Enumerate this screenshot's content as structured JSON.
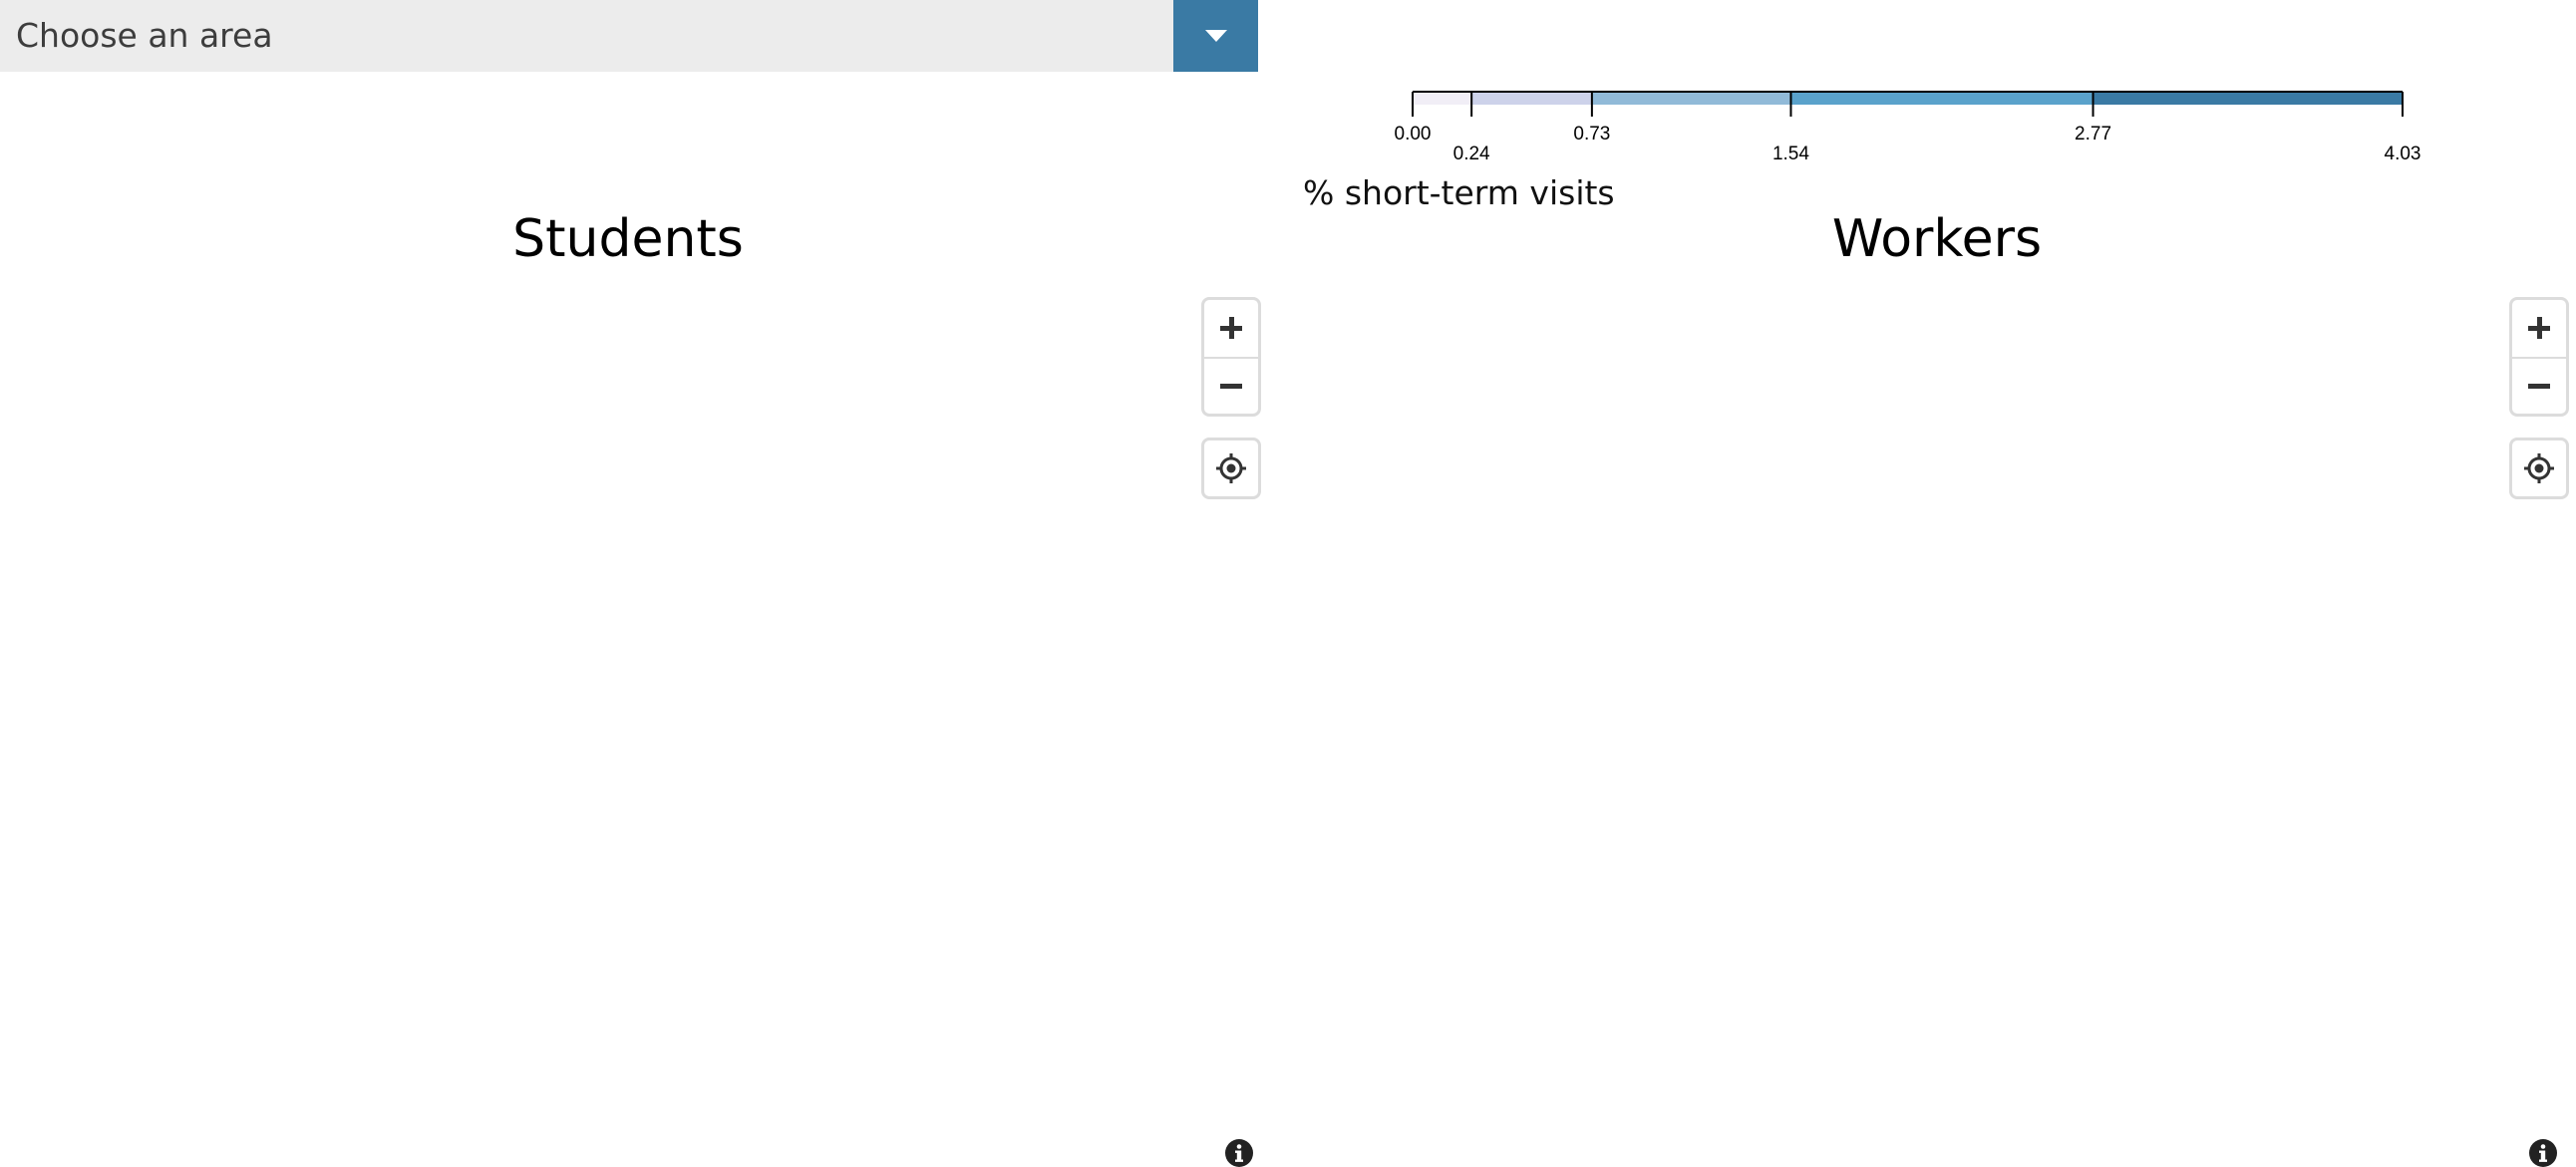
{
  "area_select": {
    "value": "Choose an area",
    "arrow_icon": "caret-down-icon",
    "accent_color": "#3a7aa4"
  },
  "legend": {
    "title": "% short-term visits",
    "breaks": [
      0.0,
      0.24,
      0.73,
      1.54,
      2.77,
      4.03
    ],
    "tick_labels": [
      "0.00",
      "0.24",
      "0.73",
      "1.54",
      "2.77",
      "4.03"
    ],
    "colors": [
      "#f1eef6",
      "#cdd2ea",
      "#91bad8",
      "#5aa2cb",
      "#3a7aa4"
    ]
  },
  "panels": {
    "students": {
      "title": "Students",
      "zoom_in_icon": "plus-icon",
      "zoom_out_icon": "minus-icon",
      "locate_icon": "locate-icon",
      "info_icon": "info-icon"
    },
    "workers": {
      "title": "Workers",
      "zoom_in_icon": "plus-icon",
      "zoom_out_icon": "minus-icon",
      "locate_icon": "locate-icon",
      "info_icon": "info-icon"
    }
  }
}
